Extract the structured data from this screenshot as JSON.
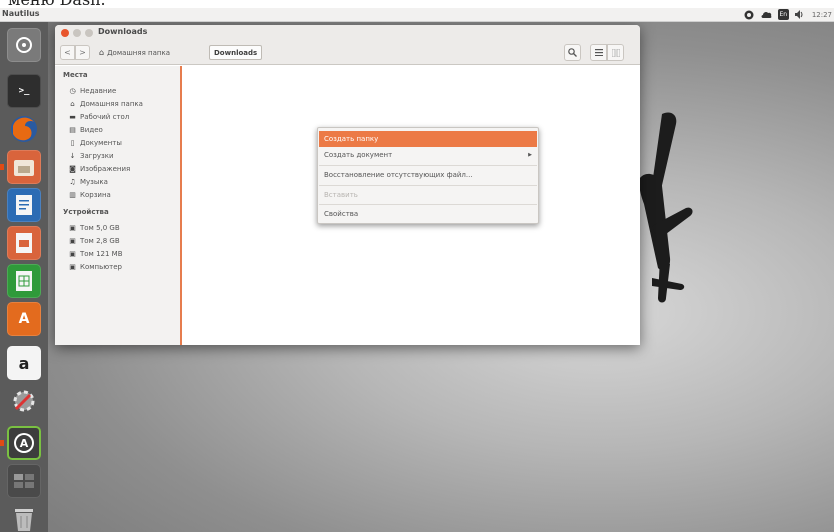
{
  "caption_fragment": "меню Dash.",
  "top_panel": {
    "app_name": "Nautilus",
    "indicators": [
      "circle-indicator-icon",
      "cloud-icon",
      "keyboard-layout-icon",
      "volume-icon"
    ],
    "keyboard_label": "En",
    "volume_label": "◂)",
    "clock": "12:27"
  },
  "launcher": {
    "icons": [
      "dash-icon",
      "terminal-icon",
      "firefox-icon",
      "file-manager-icon",
      "writer-icon",
      "impress-icon",
      "calc-icon",
      "software-center-icon",
      "amazon-icon",
      "system-settings-icon",
      "update-manager-icon",
      "workspace-switcher-icon",
      "trash-icon"
    ],
    "amazon_glyph": "a",
    "software_glyph": "A",
    "update_glyph": "A"
  },
  "window": {
    "title": "Downloads",
    "breadcrumbs": [
      "Домашняя папка",
      "Downloads"
    ]
  },
  "sidebar": {
    "places_heading": "Места",
    "places": [
      {
        "label": "Недавние",
        "icon": "clock-icon"
      },
      {
        "label": "Домашняя папка",
        "icon": "home-icon"
      },
      {
        "label": "Рабочий стол",
        "icon": "desktop-folder-icon"
      },
      {
        "label": "Видео",
        "icon": "video-icon"
      },
      {
        "label": "Документы",
        "icon": "document-icon"
      },
      {
        "label": "Загрузки",
        "icon": "download-icon"
      },
      {
        "label": "Изображения",
        "icon": "camera-icon"
      },
      {
        "label": "Музыка",
        "icon": "music-icon"
      },
      {
        "label": "Корзина",
        "icon": "trash-icon"
      }
    ],
    "devices_heading": "Устройства",
    "devices": [
      {
        "label": "Том 5,0 GB",
        "icon": "drive-icon"
      },
      {
        "label": "Том 2,8 GB",
        "icon": "drive-icon"
      },
      {
        "label": "Том 121 MB",
        "icon": "drive-icon"
      },
      {
        "label": "Компьютер",
        "icon": "computer-icon"
      }
    ]
  },
  "context_menu": {
    "items": [
      {
        "label": "Создать папку",
        "state": "highlighted"
      },
      {
        "label": "Создать документ",
        "state": "normal",
        "submenu": true
      },
      {
        "label": "Восстановление отсутствующих файл...",
        "state": "normal"
      },
      {
        "label": "Вставить",
        "state": "disabled"
      },
      {
        "label": "Свойства",
        "state": "normal"
      }
    ]
  },
  "colors": {
    "accent": "#ec7a46",
    "launcher": "#5b5b5b",
    "panel": "#f2f1f0"
  }
}
